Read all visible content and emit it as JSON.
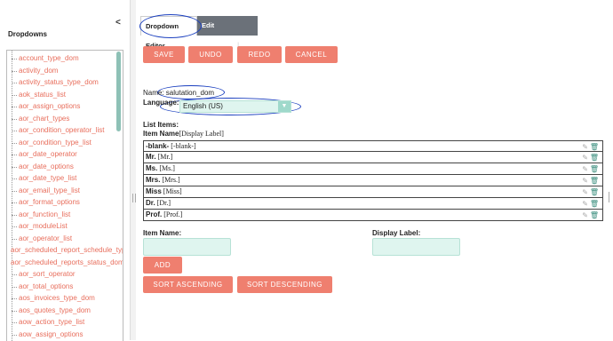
{
  "sidebar": {
    "collapse_glyph": "<",
    "title": "Dropdowns",
    "items": [
      "account_type_dom",
      "activity_dom",
      "activity_status_type_dom",
      "aok_status_list",
      "aor_assign_options",
      "aor_chart_types",
      "aor_condition_operator_list",
      "aor_condition_type_list",
      "aor_date_operator",
      "aor_date_options",
      "aor_date_type_list",
      "aor_email_type_list",
      "aor_format_options",
      "aor_function_list",
      "aor_moduleList",
      "aor_operator_list",
      "aor_scheduled_report_schedule_typ",
      "aor_scheduled_reports_status_dom",
      "aor_sort_operator",
      "aor_total_options",
      "aos_invoices_type_dom",
      "aos_quotes_type_dom",
      "aow_action_type_list",
      "aow_assign_options"
    ]
  },
  "tabs": {
    "editor": "Dropdown Editor",
    "edit": "Edit Dropdown",
    "edit_sep": "|"
  },
  "toolbar": {
    "save": "SAVE",
    "undo": "UNDO",
    "redo": "REDO",
    "cancel": "CANCEL"
  },
  "form": {
    "name_label": "Name:",
    "name_value": "salutation_dom",
    "language_label": "Language:",
    "language_value": "English (US)",
    "list_items_label": "List Items:",
    "item_name_header": "Item Name",
    "display_label_header": "[Display Label]"
  },
  "list_items": [
    {
      "name": "-blank-",
      "label": "[-blank-]"
    },
    {
      "name": "Mr.",
      "label": "[Mr.]"
    },
    {
      "name": "Ms.",
      "label": "[Ms.]"
    },
    {
      "name": "Mrs.",
      "label": "[Mrs.]"
    },
    {
      "name": "Miss",
      "label": "[Miss]"
    },
    {
      "name": "Dr.",
      "label": "[Dr.]"
    },
    {
      "name": "Prof.",
      "label": "[Prof.]"
    }
  ],
  "add_form": {
    "item_name_label": "Item Name:",
    "display_label_label": "Display Label:",
    "add_button": "ADD"
  },
  "sort": {
    "ascending": "SORT ASCENDING",
    "descending": "SORT DESCENDING"
  },
  "icons": {
    "edit": "pencil-icon",
    "delete": "trash-icon",
    "dropdown": "chevron-down-icon"
  },
  "colors": {
    "accent": "#ef7f6f",
    "link": "#e86e5c",
    "input_bg": "#dff5ef",
    "annotation": "#1a3fbf"
  }
}
